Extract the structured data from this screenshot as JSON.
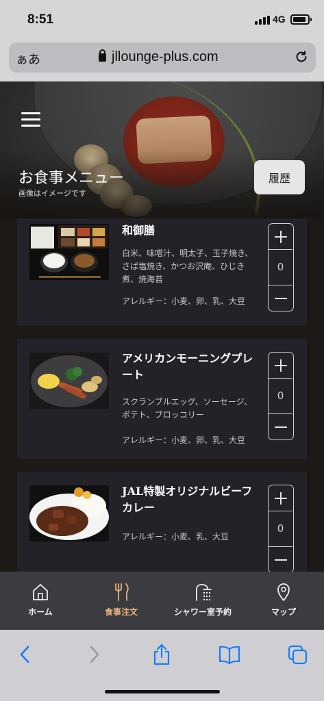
{
  "status": {
    "time": "8:51",
    "network": "4G"
  },
  "browser": {
    "aa_label": "ぁあ",
    "url": "jllounge-plus.com"
  },
  "header": {
    "title": "お食事メニュー",
    "subtitle": "画像はイメージです",
    "history_label": "履歴"
  },
  "menu_items": [
    {
      "name": "和御膳",
      "description": "白米、味噌汁、明太子、玉子焼き、さば塩焼き、かつお沢庵、ひじき煮、焼海苔",
      "allergy": "アレルギー：小麦、卵、乳、大豆",
      "quantity": "0"
    },
    {
      "name": "アメリカンモーニングプレート",
      "description": "スクランブルエッグ、ソーセージ、ポテト、ブロッコリー",
      "allergy": "アレルギー：小麦、卵、乳、大豆",
      "quantity": "0"
    },
    {
      "name": "JAL特製オリジナルビーフカレー",
      "description": "",
      "allergy": "アレルギー：小麦、乳、大豆",
      "quantity": "0"
    }
  ],
  "tabs": [
    {
      "label": "ホーム",
      "icon": "home-icon",
      "active": false
    },
    {
      "label": "食事注文",
      "icon": "fork-knife-icon",
      "active": true
    },
    {
      "label": "シャワー室予約",
      "icon": "shower-icon",
      "active": false
    },
    {
      "label": "マップ",
      "icon": "map-pin-icon",
      "active": false
    }
  ],
  "colors": {
    "accent": "#e6b27a",
    "ios_blue": "#1a7cf5",
    "card_bg": "#242229"
  }
}
